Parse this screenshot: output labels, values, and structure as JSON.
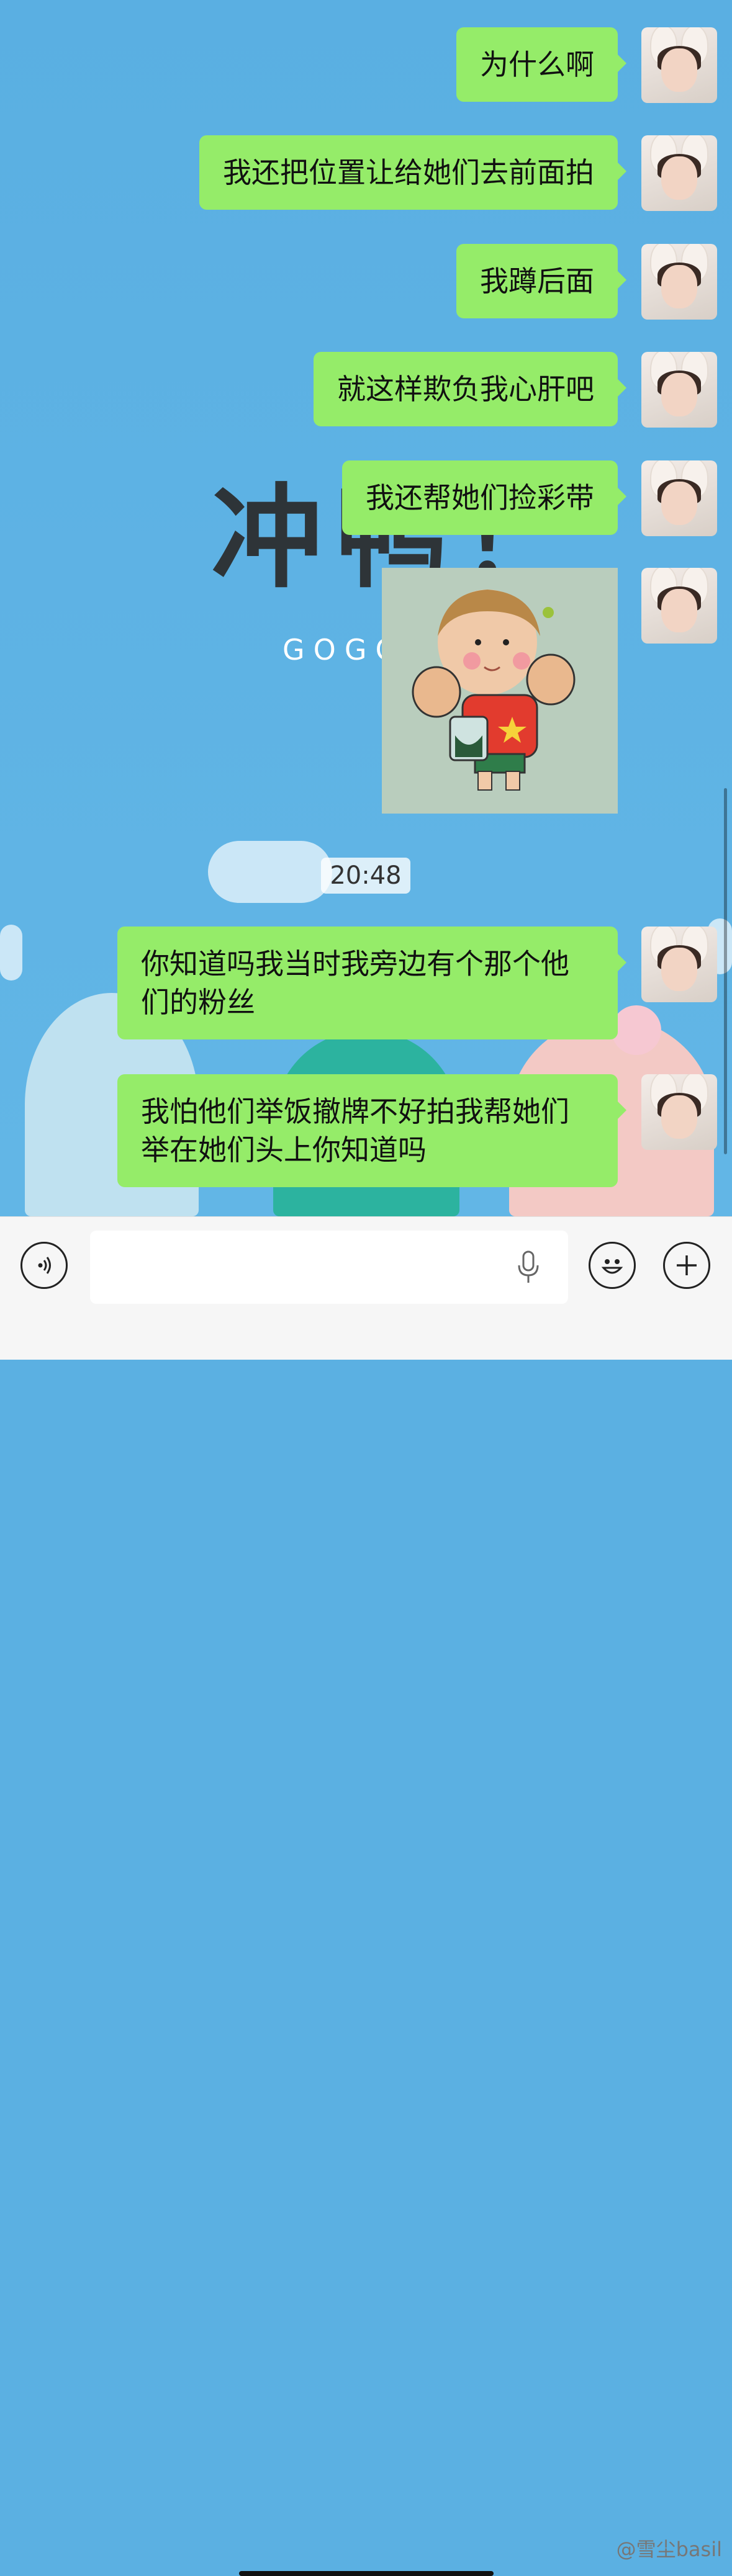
{
  "messages": [
    {
      "text": "为什么啊"
    },
    {
      "text": "我还把位置让给她们去前面拍"
    },
    {
      "text": "我蹲后面"
    },
    {
      "text": "就这样欺负我心肝吧"
    },
    {
      "text": "我还帮她们捡彩带"
    },
    {
      "text": "你知道吗我当时我旁边有个那个他们的粉丝"
    },
    {
      "text": "我怕他们举饭撤牌不好拍我帮她们举在她们头上你知道吗"
    }
  ],
  "timestamp": "20:48",
  "wallpaper": {
    "title": "冲鸭！",
    "subtitle": "GOGO"
  },
  "input_bar": {
    "voice_icon": "voice-toggle-icon",
    "mic_icon": "microphone-icon",
    "emoji_icon": "emoji-icon",
    "plus_icon": "plus-icon"
  },
  "watermark": "@雪尘basil",
  "colors": {
    "bubble": "#95ec69",
    "background": "#5bb0e2"
  }
}
